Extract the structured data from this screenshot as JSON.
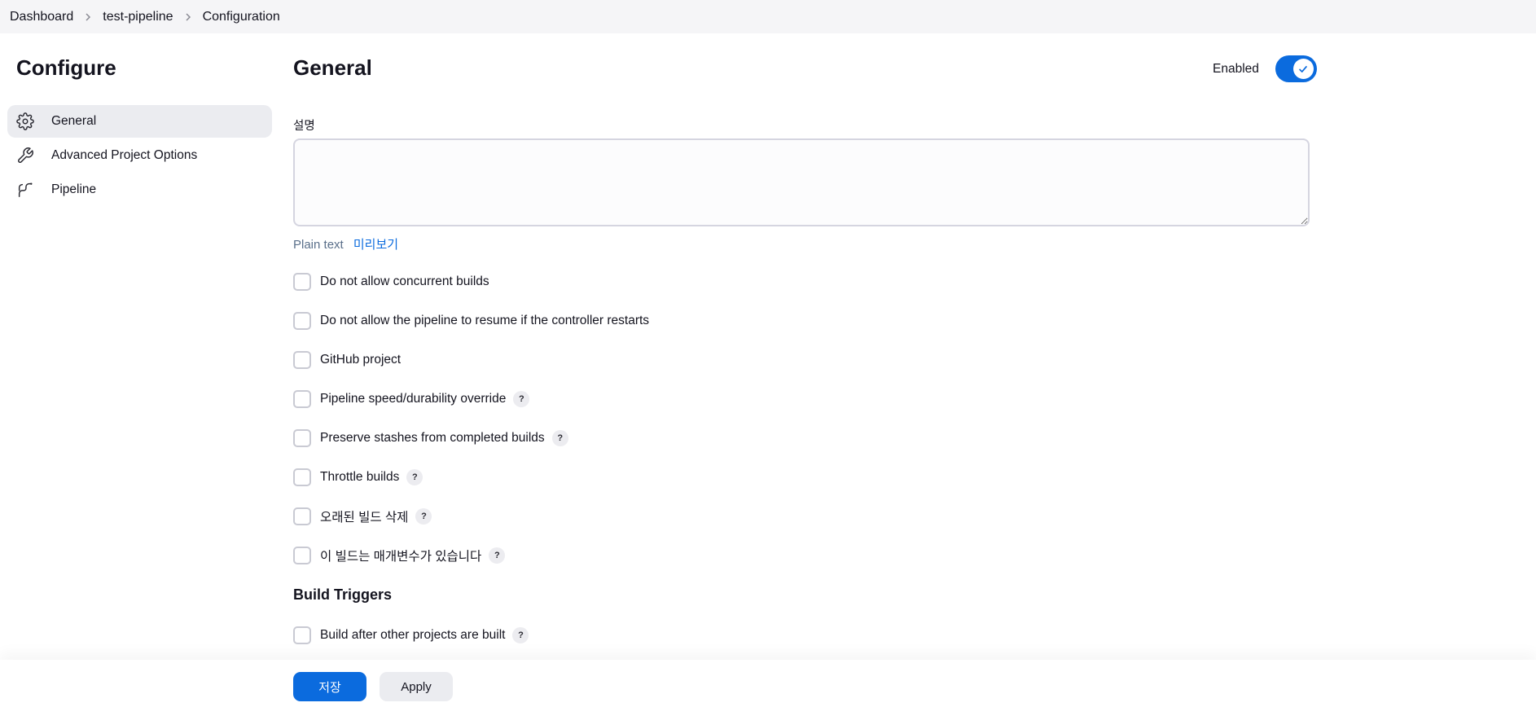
{
  "breadcrumb": {
    "items": [
      "Dashboard",
      "test-pipeline",
      "Configuration"
    ]
  },
  "sidebar": {
    "title": "Configure",
    "items": [
      {
        "label": "General",
        "icon": "gear-icon",
        "active": true
      },
      {
        "label": "Advanced Project Options",
        "icon": "wrench-icon",
        "active": false
      },
      {
        "label": "Pipeline",
        "icon": "pipeline-icon",
        "active": false
      }
    ]
  },
  "main": {
    "title": "General",
    "enabled_label": "Enabled",
    "enabled": true,
    "description_label": "설명",
    "description_value": "",
    "format_plain": "Plain text",
    "format_preview": "미리보기",
    "options": [
      {
        "label": "Do not allow concurrent builds",
        "help": false,
        "checked": false
      },
      {
        "label": "Do not allow the pipeline to resume if the controller restarts",
        "help": false,
        "checked": false
      },
      {
        "label": "GitHub project",
        "help": false,
        "checked": false
      },
      {
        "label": "Pipeline speed/durability override",
        "help": true,
        "checked": false
      },
      {
        "label": "Preserve stashes from completed builds",
        "help": true,
        "checked": false
      },
      {
        "label": "Throttle builds",
        "help": true,
        "checked": false
      },
      {
        "label": "오래된 빌드 삭제",
        "help": true,
        "checked": false
      },
      {
        "label": "이 빌드는 매개변수가 있습니다",
        "help": true,
        "checked": false
      }
    ],
    "build_triggers_title": "Build Triggers",
    "build_triggers": [
      {
        "label": "Build after other projects are built",
        "help": true,
        "checked": false
      }
    ],
    "help_glyph": "?"
  },
  "actions": {
    "save_label": "저장",
    "apply_label": "Apply"
  },
  "colors": {
    "accent": "#0b6bde",
    "active_nav_bg": "#ebecf0",
    "topbar_bg": "#f5f5f7"
  }
}
